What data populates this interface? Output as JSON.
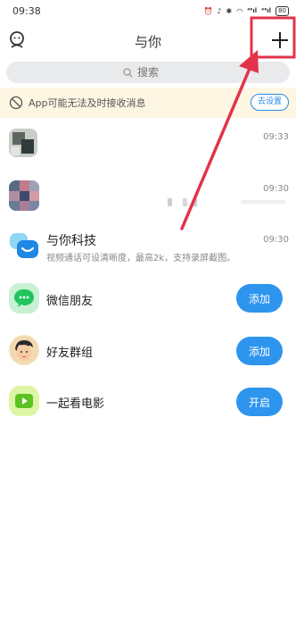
{
  "status_bar": {
    "time": "09:38",
    "signal_a": "⁴⁶ıl",
    "signal_b": "⁴⁶ıl",
    "battery": "80"
  },
  "header": {
    "title": "与你",
    "left_icon": "assistant-icon",
    "right_icon": "plus-icon"
  },
  "search": {
    "placeholder": "搜索"
  },
  "notice": {
    "text": "App可能无法及时接收消息",
    "button_label": "去设置"
  },
  "chats": [
    {
      "time": "09:33"
    },
    {
      "time": "09:30"
    },
    {
      "title": "与你科技",
      "subtitle": "视频通话可设清晰度，最高2k，支持录屏截图。",
      "time": "09:30"
    }
  ],
  "features": [
    {
      "label": "微信朋友",
      "button": "添加",
      "icon": "wechat-bubble-icon"
    },
    {
      "label": "好友群组",
      "button": "添加",
      "icon": "group-avatar-icon"
    },
    {
      "label": "一起看电影",
      "button": "开启",
      "icon": "movie-play-icon"
    }
  ],
  "colors": {
    "accent": "#2e95ee",
    "notice_bg": "#fdf6e3",
    "annotation_arrow": "#e2334a"
  }
}
